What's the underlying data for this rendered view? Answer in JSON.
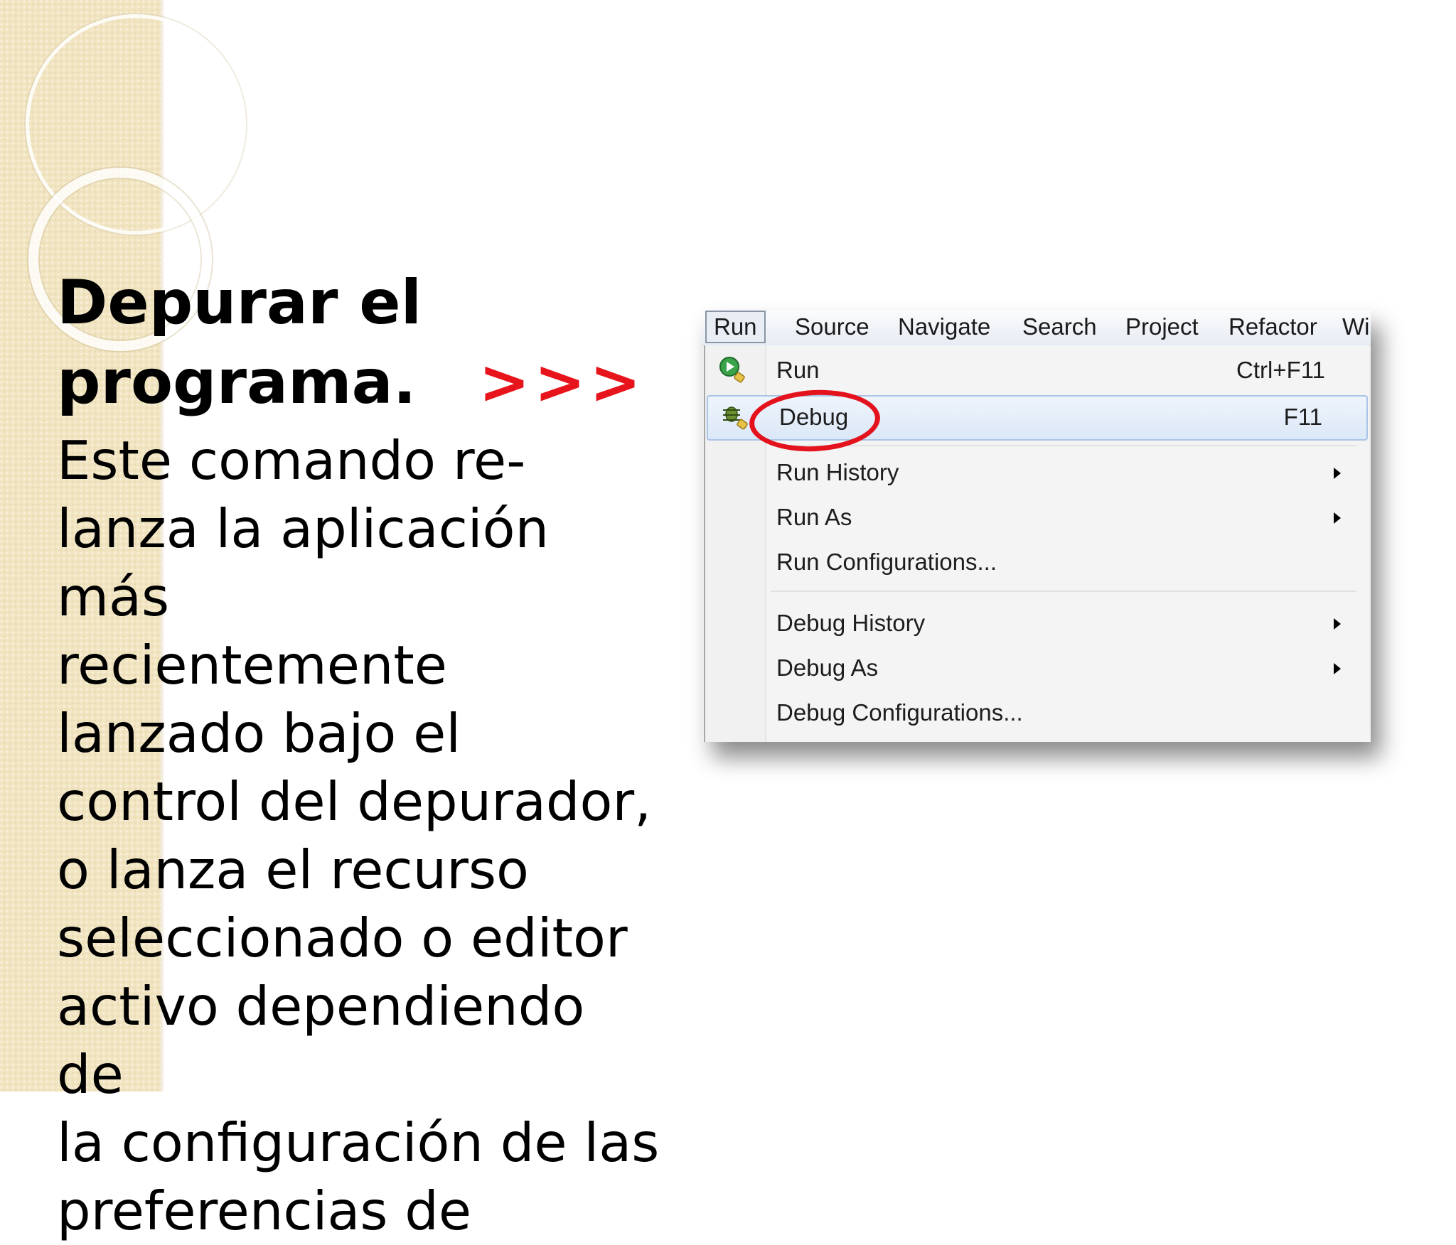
{
  "slide": {
    "title_line1": "Depurar el",
    "title_line2": "programa.",
    "title_arrows": ">>>",
    "body": "Este comando re-\nlanza la aplicación más\nrecientemente\nlanzado bajo el\ncontrol del depurador,\no lanza el recurso\nseleccionado o editor\nactivo dependiendo de\nla configuración de las\npreferencias de"
  },
  "colors": {
    "arrows": "#e8141c",
    "annotation": "#e3121c",
    "side_band": "#f1e4c0",
    "highlight": "#dce8f7"
  },
  "menubar": {
    "items": [
      "Run",
      "Source",
      "Navigate",
      "Search",
      "Project",
      "Refactor",
      "Wir"
    ]
  },
  "run_menu": {
    "run": {
      "label": "Run",
      "shortcut": "Ctrl+F11",
      "icon": "run-icon"
    },
    "debug": {
      "label": "Debug",
      "shortcut": "F11",
      "icon": "debug-icon",
      "highlighted": true
    },
    "run_history": {
      "label": "Run History"
    },
    "run_as": {
      "label": "Run As"
    },
    "run_configurations": {
      "label": "Run Configurations..."
    },
    "debug_history": {
      "label": "Debug History"
    },
    "debug_as": {
      "label": "Debug As"
    },
    "debug_configurations": {
      "label": "Debug Configurations..."
    }
  }
}
